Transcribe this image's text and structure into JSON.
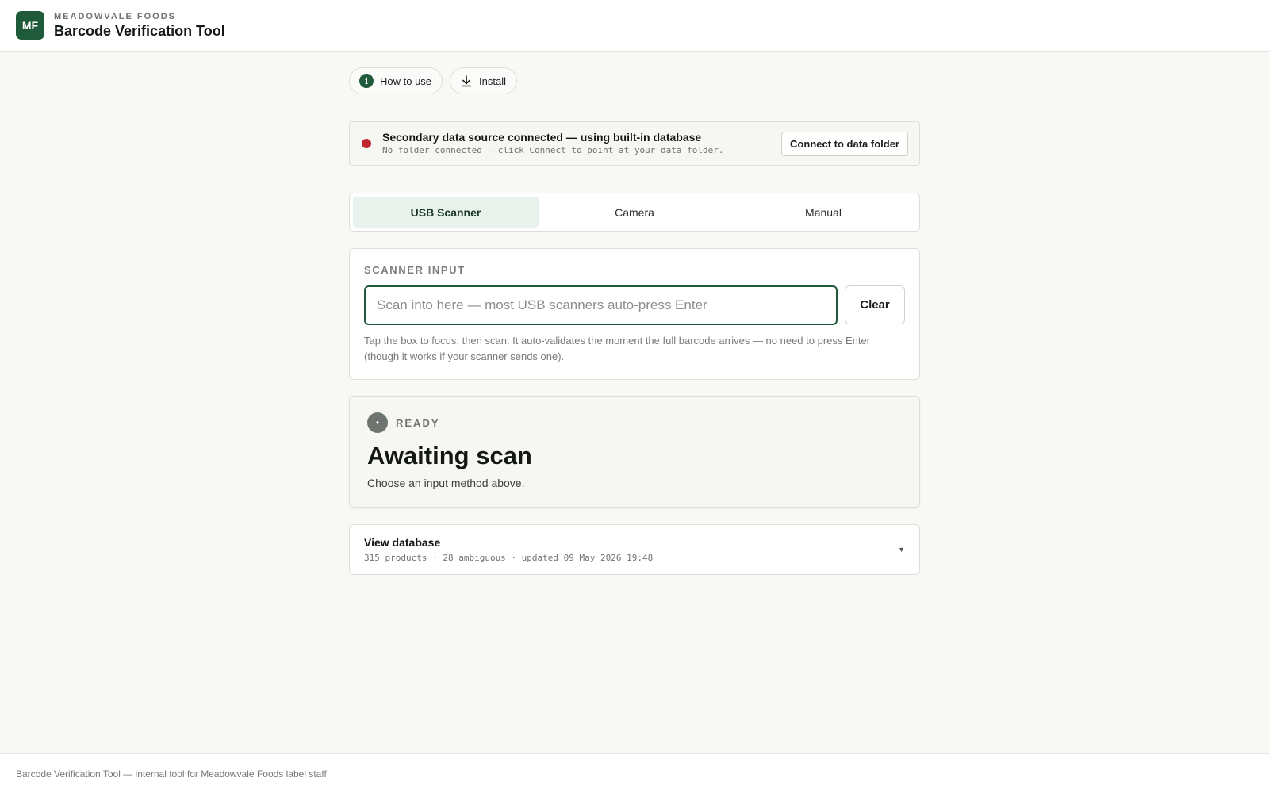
{
  "header": {
    "logo_text": "MF",
    "company": "MEADOWVALE FOODS",
    "title": "Barcode Verification Tool"
  },
  "actions": {
    "how_to_use": "How to use",
    "install": "Install"
  },
  "status": {
    "title": "Secondary data source connected — using built-in database",
    "subtitle": "No folder connected — click Connect to point at your data folder.",
    "connect_button": "Connect to data folder",
    "indicator_color": "#c0262d"
  },
  "tabs": [
    {
      "label": "USB Scanner",
      "active": true
    },
    {
      "label": "Camera",
      "active": false
    },
    {
      "label": "Manual",
      "active": false
    }
  ],
  "scanner": {
    "section_label": "SCANNER INPUT",
    "placeholder": "Scan into here — most USB scanners auto-press Enter",
    "value": "",
    "clear_button": "Clear",
    "help": "Tap the box to focus, then scan. It auto-validates the moment the full barcode arrives — no need to press Enter (though it works if your scanner sends one)."
  },
  "result": {
    "status_label": "READY",
    "title": "Awaiting scan",
    "subtitle": "Choose an input method above."
  },
  "database": {
    "title": "View database",
    "meta": "315 products · 28 ambiguous · updated 09 May 2026 19:48"
  },
  "footer": {
    "text": "Barcode Verification Tool — internal tool for Meadowvale Foods label staff"
  },
  "colors": {
    "accent": "#1f5a3a",
    "background": "#f8f8f5",
    "active_tab": "#e8f1ec"
  }
}
